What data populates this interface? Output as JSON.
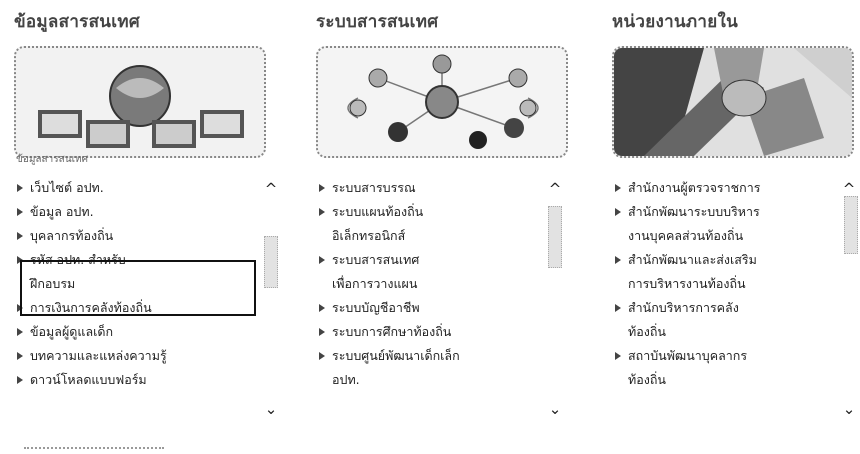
{
  "columns": [
    {
      "title": "ข้อมูลสารสนเทศ",
      "caption": "ข้อมูลสารสนเทศ",
      "links": [
        {
          "label": "เว็บไซต์ อปท."
        },
        {
          "label": "ข้อมูล อปท."
        },
        {
          "label": "บุคลากรท้องถิ่น"
        },
        {
          "label": "รหัส อปท. สำหรับ",
          "sub": "ฝึกอบรม"
        },
        {
          "label": "การเงินการคลังท้องถิ่น"
        },
        {
          "label": "ข้อมูลผู้ดูแลเด็ก"
        },
        {
          "label": "บทความและแหล่งความรู้"
        },
        {
          "label": "ดาวน์โหลดแบบฟอร์ม"
        }
      ]
    },
    {
      "title": "ระบบสารสนเทศ",
      "links": [
        {
          "label": "ระบบสารบรรณ"
        },
        {
          "label": "ระบบแผนท้องถิ่น",
          "sub": "อิเล็กทรอนิกส์"
        },
        {
          "label": "ระบบสารสนเทศ",
          "sub": "เพื่อการวางแผน"
        },
        {
          "label": "ระบบบัญชีอาชีพ"
        },
        {
          "label": "ระบบการศึกษาท้องถิ่น"
        },
        {
          "label": "ระบบศูนย์พัฒนาเด็กเล็ก",
          "sub": "อปท."
        }
      ]
    },
    {
      "title": "หน่วยงานภายใน",
      "links": [
        {
          "label": "สำนักงานผู้ตรวจราชการ"
        },
        {
          "label": "สำนักพัฒนาระบบบริหาร",
          "sub": "งานบุคคลส่วนท้องถิ่น"
        },
        {
          "label": "สำนักพัฒนาและส่งเสริม",
          "sub": "การบริหารงานท้องถิ่น"
        },
        {
          "label": "สำนักบริหารการคลัง",
          "sub": "ท้องถิ่น"
        },
        {
          "label": "สถาบันพัฒนาบุคลากร",
          "sub": "ท้องถิ่น"
        }
      ]
    }
  ],
  "icons": {
    "up": "chevron-up-icon",
    "down": "chevron-down-icon"
  },
  "scroll_up_glyph": "^",
  "scroll_down_glyph": "⌄"
}
